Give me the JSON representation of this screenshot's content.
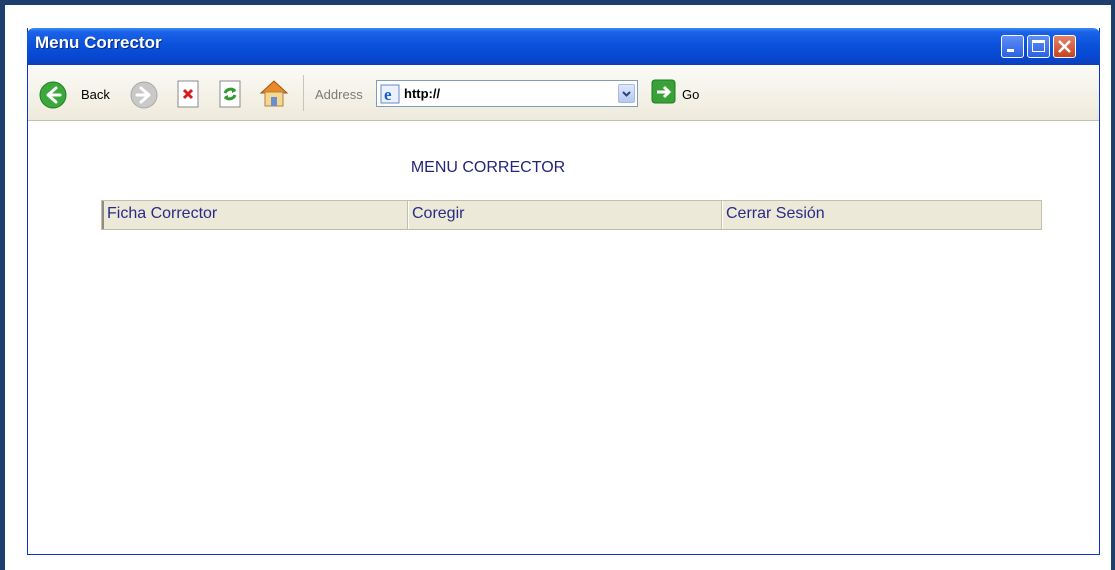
{
  "window": {
    "title": "Menu Corrector"
  },
  "toolbar": {
    "back_label": "Back",
    "address_label": "Address",
    "address_value": "http://",
    "go_label": "Go"
  },
  "page": {
    "heading": "MENU CORRECTOR",
    "menu": [
      "Ficha Corrector",
      "Coregir",
      "Cerrar Sesión"
    ]
  },
  "colors": {
    "titlebar": "#0a52db",
    "menu_bg": "#ece9d8",
    "menu_text": "#2a2a86"
  }
}
